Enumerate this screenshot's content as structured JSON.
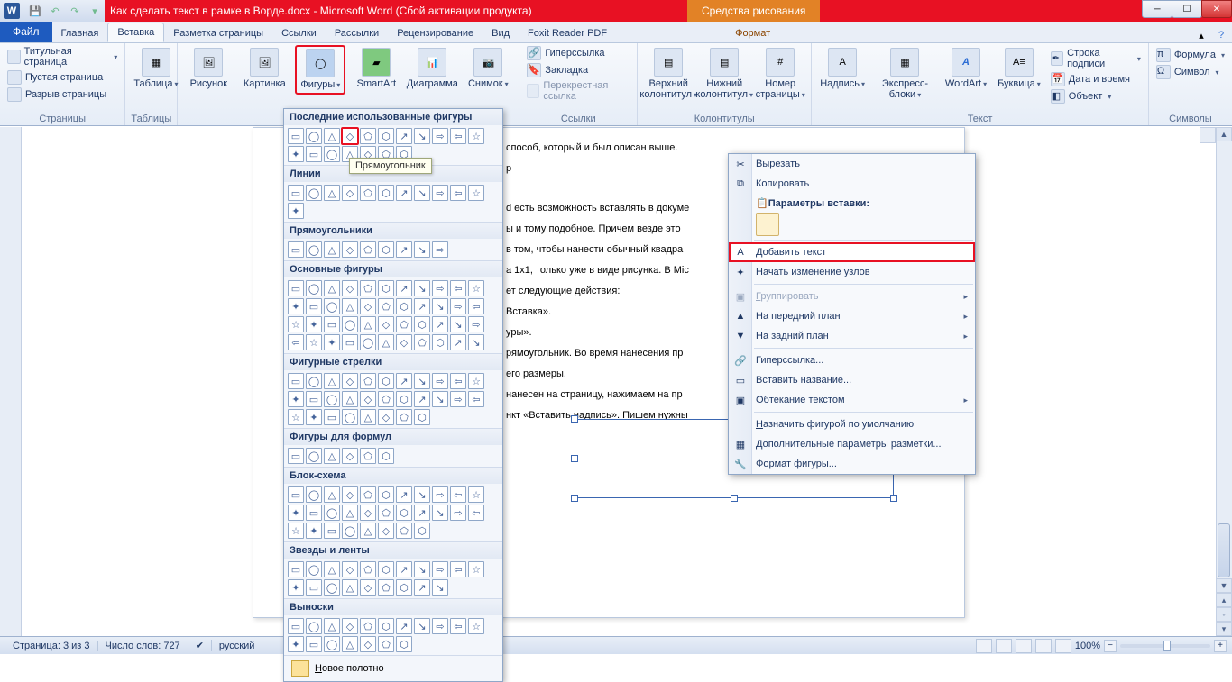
{
  "titlebar": {
    "doc_title": "Как сделать текст в рамке в Ворде.docx - Microsoft Word (Сбой активации продукта)",
    "drawing_tools": "Средства рисования"
  },
  "tabs": {
    "file": "Файл",
    "home": "Главная",
    "insert": "Вставка",
    "page_layout": "Разметка страницы",
    "references": "Ссылки",
    "mailings": "Рассылки",
    "review": "Рецензирование",
    "view": "Вид",
    "foxit": "Foxit Reader PDF",
    "format": "Формат"
  },
  "ribbon": {
    "pages": {
      "label": "Страницы",
      "cover": "Титульная страница",
      "blank": "Пустая страница",
      "break": "Разрыв страницы"
    },
    "tables": {
      "label": "Таблицы",
      "table": "Таблица"
    },
    "illustrations": {
      "picture": "Рисунок",
      "clipart": "Картинка",
      "shapes": "Фигуры",
      "smartart": "SmartArt",
      "chart": "Диаграмма",
      "screenshot": "Снимок"
    },
    "links": {
      "label": "Ссылки",
      "hyperlink": "Гиперссылка",
      "bookmark": "Закладка",
      "crossref": "Перекрестная ссылка"
    },
    "headerfooter": {
      "label": "Колонтитулы",
      "header": "Верхний колонтитул",
      "footer": "Нижний колонтитул",
      "pagenum": "Номер страницы"
    },
    "text": {
      "label": "Текст",
      "textbox": "Надпись",
      "quickparts": "Экспресс-блоки",
      "wordart": "WordArt",
      "dropcap": "Буквица",
      "sigline": "Строка подписи",
      "datetime": "Дата и время",
      "object": "Объект"
    },
    "symbols": {
      "label": "Символы",
      "equation": "Формула",
      "symbol": "Символ"
    }
  },
  "gallery": {
    "recent": "Последние использованные фигуры",
    "lines": "Линии",
    "rects": "Прямоугольники",
    "basic": "Основные фигуры",
    "arrows": "Фигурные стрелки",
    "equation": "Фигуры для формул",
    "flowchart": "Блок-схема",
    "stars": "Звезды и ленты",
    "callouts": "Выноски",
    "new_canvas": "Новое полотно",
    "tooltip": "Прямоугольник"
  },
  "doc": {
    "l1": "способ, который и был описан выше.",
    "l2": "р",
    "l3": "d есть возможность вставлять в докуме",
    "l4": "ы и тому подобное. Причем везде это",
    "l5": "в том, чтобы нанести обычный квадра",
    "l6": "а 1х1, только уже в виде рисунка. В Mic",
    "l7": "ет следующие действия:",
    "l8": "Вставка».",
    "l9": "уры».",
    "l10": "рямоугольник. Во время нанесения пр",
    "l11": "его размеры.",
    "l12": "нанесен на страницу, нажимаем на пр",
    "l13": "нкт «Вставить надпись». Пишем нужны"
  },
  "context": {
    "cut": "Вырезать",
    "copy": "Копировать",
    "paste_options": "Параметры вставки:",
    "add_text": "Добавить текст",
    "edit_points": "Начать изменение узлов",
    "group": "Группировать",
    "bring_front": "На передний план",
    "send_back": "На задний план",
    "hyperlink": "Гиперссылка...",
    "caption": "Вставить название...",
    "wrap": "Обтекание текстом",
    "set_default": "Назначить фигурой по умолчанию",
    "more_layout": "Дополнительные параметры разметки...",
    "format_shape": "Формат фигуры..."
  },
  "status": {
    "page": "Страница: 3 из 3",
    "words": "Число слов: 727",
    "lang": "русский",
    "zoom": "100%"
  }
}
